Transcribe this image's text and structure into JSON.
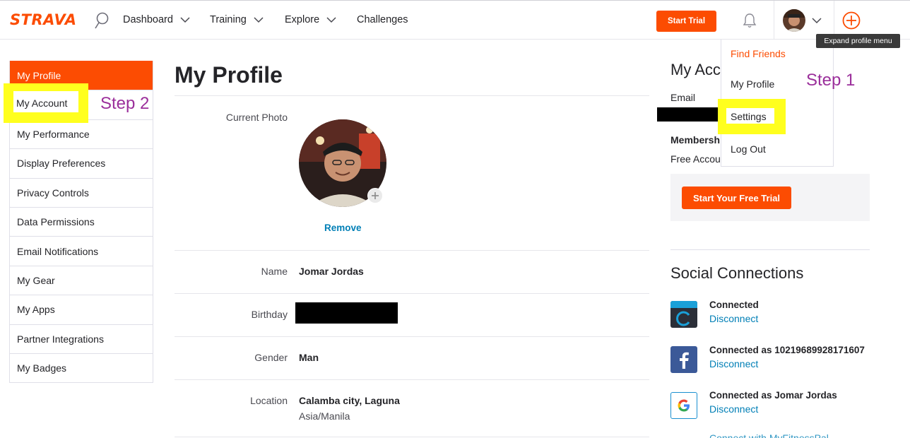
{
  "nav": {
    "logo": "STRAVA",
    "items": [
      "Dashboard",
      "Training",
      "Explore",
      "Challenges"
    ],
    "start_trial": "Start Trial",
    "tooltip": "Expand profile menu",
    "brand_color": "#fc4c02"
  },
  "dropdown": {
    "find_friends": "Find Friends",
    "my_profile": "My Profile",
    "settings": "Settings",
    "log_out": "Log Out"
  },
  "annotations": {
    "step1": "Step 1",
    "step2": "Step 2",
    "highlight_color": "#ffff1e",
    "text_color": "#9b2f9b"
  },
  "sidebar": {
    "items": [
      "My Profile",
      "My Account",
      "My Performance",
      "Display Preferences",
      "Privacy Controls",
      "Data Permissions",
      "Email Notifications",
      "My Gear",
      "My Apps",
      "Partner Integrations",
      "My Badges"
    ]
  },
  "profile": {
    "title": "My Profile",
    "photo_label": "Current Photo",
    "remove": "Remove",
    "name_label": "Name",
    "name": "Jomar Jordas",
    "birthday_label": "Birthday",
    "gender_label": "Gender",
    "gender": "Man",
    "location_label": "Location",
    "location": "Calamba city, Laguna",
    "timezone": "Asia/Manila"
  },
  "account": {
    "title": "My Acc",
    "email_label": "Email",
    "membership_label": "Membersh",
    "membership": "Free Accou",
    "free_trial": "Start Your Free Trial"
  },
  "social": {
    "title": "Social Connections",
    "connections": [
      {
        "icon": "garmin-icon",
        "status": "Connected",
        "action": "Disconnect"
      },
      {
        "icon": "facebook-icon",
        "status": "Connected as 10219689928171607",
        "action": "Disconnect"
      },
      {
        "icon": "google-icon",
        "status": "Connected as Jomar Jordas",
        "action": "Disconnect"
      }
    ],
    "partial": "Connect with MyFitnessPal"
  }
}
